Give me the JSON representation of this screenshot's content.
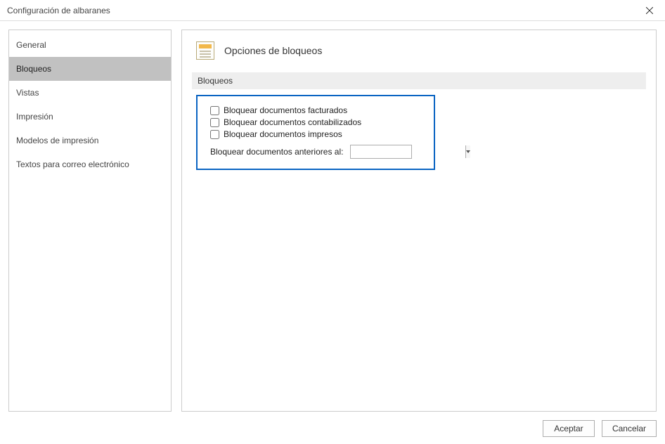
{
  "window": {
    "title": "Configuración de albaranes"
  },
  "sidebar": {
    "items": [
      {
        "label": "General"
      },
      {
        "label": "Bloqueos"
      },
      {
        "label": "Vistas"
      },
      {
        "label": "Impresión"
      },
      {
        "label": "Modelos de impresión"
      },
      {
        "label": "Textos para correo electrónico"
      }
    ],
    "selected_index": 1
  },
  "page": {
    "title": "Opciones de bloqueos",
    "section_header": "Bloqueos",
    "checkboxes": [
      {
        "label": "Bloquear documentos facturados",
        "checked": false
      },
      {
        "label": "Bloquear documentos contabilizados",
        "checked": false
      },
      {
        "label": "Bloquear documentos impresos",
        "checked": false
      }
    ],
    "date_label": "Bloquear documentos anteriores al:",
    "date_value": ""
  },
  "footer": {
    "accept": "Aceptar",
    "cancel": "Cancelar"
  }
}
